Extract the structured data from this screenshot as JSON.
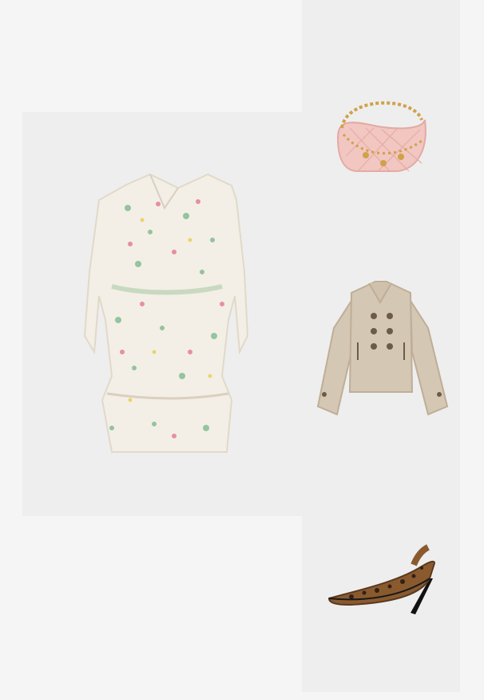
{
  "outfit": {
    "items": [
      {
        "slot": "dress",
        "icon": "floral-dress-icon",
        "colors": {
          "base": "#f3efe6",
          "accent": "#8fc29a",
          "pink": "#e58aa1"
        }
      },
      {
        "slot": "bag",
        "icon": "quilted-shoulder-bag-icon",
        "colors": {
          "base": "#f2c6c1",
          "chain": "#cfa24a"
        }
      },
      {
        "slot": "jacket",
        "icon": "trench-jacket-icon",
        "colors": {
          "base": "#d4c7b3",
          "buttons": "#6d5b47"
        }
      },
      {
        "slot": "shoe",
        "icon": "leopard-slingback-pump-icon",
        "colors": {
          "base": "#8a5a2f",
          "spots": "#2a1b10"
        }
      }
    ]
  }
}
